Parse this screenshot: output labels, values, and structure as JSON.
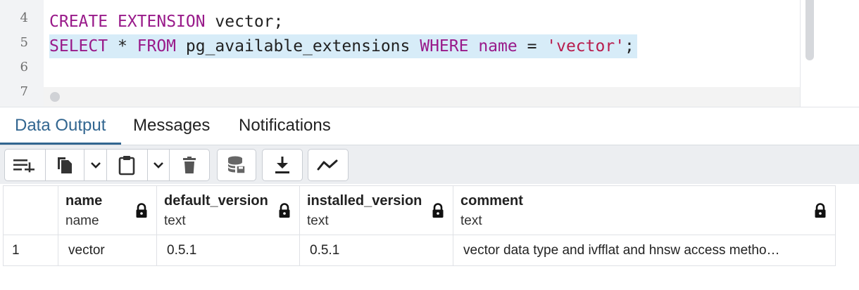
{
  "editor": {
    "lines": [
      {
        "number": "4",
        "text": "CREATE EXTENSION vector;"
      },
      {
        "number": "5",
        "text": "SELECT * FROM pg_available_extensions WHERE name = 'vector';"
      },
      {
        "number": "6",
        "text": ""
      },
      {
        "number": "7",
        "text": ""
      }
    ],
    "tokens": {
      "create": "CREATE",
      "extension": "EXTENSION",
      "vector_stmt": " vector;",
      "select": "SELECT",
      "star": " * ",
      "from": "FROM",
      "table": " pg_available_extensions ",
      "where": "WHERE",
      "name": "name",
      "eq": " = ",
      "literal": "'vector'",
      "semi": ";"
    }
  },
  "tabs": [
    {
      "label": "Data Output",
      "active": true
    },
    {
      "label": "Messages",
      "active": false
    },
    {
      "label": "Notifications",
      "active": false
    }
  ],
  "toolbar": {
    "buttons": [
      {
        "icon": "add-row-icon"
      },
      {
        "icon": "copy-icon"
      },
      {
        "icon": "chevron-down-icon"
      },
      {
        "icon": "paste-icon"
      },
      {
        "icon": "chevron-down-icon"
      },
      {
        "icon": "delete-icon"
      },
      {
        "icon": "save-data-icon"
      },
      {
        "icon": "download-icon"
      },
      {
        "icon": "graph-visualiser-icon"
      }
    ]
  },
  "grid": {
    "columns": [
      {
        "name": "name",
        "type": "name"
      },
      {
        "name": "default_version",
        "type": "text"
      },
      {
        "name": "installed_version",
        "type": "text"
      },
      {
        "name": "comment",
        "type": "text"
      }
    ],
    "rows": [
      {
        "num": "1",
        "cells": [
          "vector",
          "0.5.1",
          "0.5.1",
          "vector data type and ivfflat and hnsw access metho…"
        ]
      }
    ]
  },
  "colors": {
    "keyword": "#991a8a",
    "string": "#b81c4d",
    "accent": "#326690",
    "selection": "#d7ecf8"
  }
}
